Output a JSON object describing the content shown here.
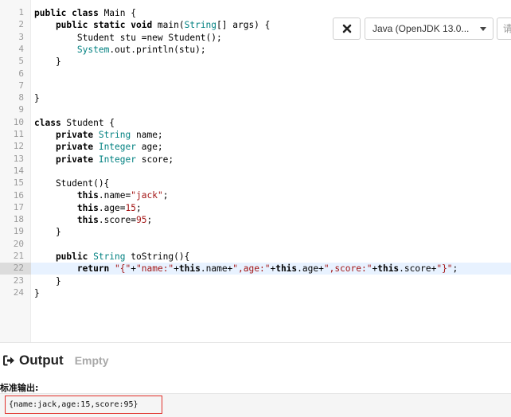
{
  "editor": {
    "line_numbers": [
      "1",
      "2",
      "3",
      "4",
      "5",
      "6",
      "7",
      "8",
      "9",
      "10",
      "11",
      "12",
      "13",
      "14",
      "15",
      "16",
      "17",
      "18",
      "19",
      "20",
      "21",
      "22",
      "23",
      "24"
    ],
    "active_line": "22",
    "lines": [
      [
        {
          "t": "public class ",
          "c": "kw"
        },
        {
          "t": "Main {",
          "c": "plain"
        }
      ],
      [
        {
          "t": "    public static void ",
          "c": "kw"
        },
        {
          "t": "main(",
          "c": "plain"
        },
        {
          "t": "String",
          "c": "type"
        },
        {
          "t": "[] args) {",
          "c": "plain"
        }
      ],
      [
        {
          "t": "        Student stu =new Student();",
          "c": "plain"
        }
      ],
      [
        {
          "t": "        ",
          "c": "plain"
        },
        {
          "t": "System",
          "c": "type"
        },
        {
          "t": ".out.println(stu);",
          "c": "plain"
        }
      ],
      [
        {
          "t": "    }",
          "c": "plain"
        }
      ],
      [],
      [],
      [
        {
          "t": "}",
          "c": "plain"
        }
      ],
      [],
      [
        {
          "t": "class ",
          "c": "kw"
        },
        {
          "t": "Student {",
          "c": "plain"
        }
      ],
      [
        {
          "t": "    private ",
          "c": "kw"
        },
        {
          "t": "String",
          "c": "type"
        },
        {
          "t": " name;",
          "c": "plain"
        }
      ],
      [
        {
          "t": "    private ",
          "c": "kw"
        },
        {
          "t": "Integer",
          "c": "type"
        },
        {
          "t": " age;",
          "c": "plain"
        }
      ],
      [
        {
          "t": "    private ",
          "c": "kw"
        },
        {
          "t": "Integer",
          "c": "type"
        },
        {
          "t": " score;",
          "c": "plain"
        }
      ],
      [],
      [
        {
          "t": "    Student(){",
          "c": "plain"
        }
      ],
      [
        {
          "t": "        ",
          "c": "plain"
        },
        {
          "t": "this",
          "c": "kw"
        },
        {
          "t": ".name=",
          "c": "plain"
        },
        {
          "t": "\"jack\"",
          "c": "str"
        },
        {
          "t": ";",
          "c": "plain"
        }
      ],
      [
        {
          "t": "        ",
          "c": "plain"
        },
        {
          "t": "this",
          "c": "kw"
        },
        {
          "t": ".age=",
          "c": "plain"
        },
        {
          "t": "15",
          "c": "num"
        },
        {
          "t": ";",
          "c": "plain"
        }
      ],
      [
        {
          "t": "        ",
          "c": "plain"
        },
        {
          "t": "this",
          "c": "kw"
        },
        {
          "t": ".score=",
          "c": "plain"
        },
        {
          "t": "95",
          "c": "num"
        },
        {
          "t": ";",
          "c": "plain"
        }
      ],
      [
        {
          "t": "    }",
          "c": "plain"
        }
      ],
      [],
      [
        {
          "t": "    public ",
          "c": "kw"
        },
        {
          "t": "String",
          "c": "type"
        },
        {
          "t": " toString(){",
          "c": "plain"
        }
      ],
      [
        {
          "t": "        return ",
          "c": "kw"
        },
        {
          "t": "\"{\"",
          "c": "str"
        },
        {
          "t": "+",
          "c": "plain"
        },
        {
          "t": "\"name:\"",
          "c": "str"
        },
        {
          "t": "+",
          "c": "plain"
        },
        {
          "t": "this",
          "c": "kw"
        },
        {
          "t": ".name+",
          "c": "plain"
        },
        {
          "t": "\",age:\"",
          "c": "str"
        },
        {
          "t": "+",
          "c": "plain"
        },
        {
          "t": "this",
          "c": "kw"
        },
        {
          "t": ".age+",
          "c": "plain"
        },
        {
          "t": "\",score:\"",
          "c": "str"
        },
        {
          "t": "+",
          "c": "plain"
        },
        {
          "t": "this",
          "c": "kw"
        },
        {
          "t": ".score+",
          "c": "plain"
        },
        {
          "t": "\"}\"",
          "c": "str"
        },
        {
          "t": ";",
          "c": "plain"
        }
      ],
      [
        {
          "t": "    }",
          "c": "plain"
        }
      ],
      [
        {
          "t": "}",
          "c": "plain"
        }
      ]
    ]
  },
  "toolbar": {
    "clear_icon": "close-icon",
    "clear_glyph": "✖",
    "language_selected": "Java (OpenJDK 13.0...",
    "stdin_placeholder": "请"
  },
  "output": {
    "icon": "sign-out-icon",
    "title": "Output",
    "status": "Empty",
    "stdout_label": "标准输出:",
    "stdout_value": "{name:jack,age:15,score:95}"
  },
  "colors": {
    "keyword": "#000000",
    "type": "#008080",
    "string": "#a31515",
    "highlight_box": "#e0312b"
  }
}
